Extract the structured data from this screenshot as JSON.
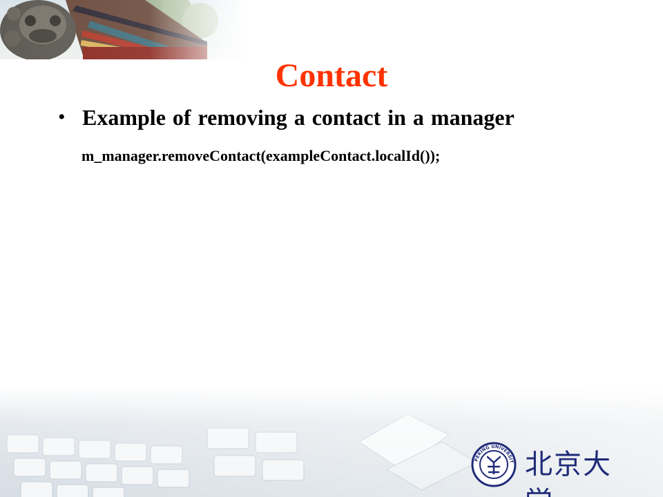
{
  "slide": {
    "title": "Contact",
    "bullet": {
      "marker": "•",
      "text": "Example of removing a contact in a manager"
    },
    "code": "m_manager.removeContact(exampleContact.localId());"
  },
  "logo": {
    "seal_text": "PEKING UNIVERSITY 1898",
    "name": "北京大学"
  },
  "colors": {
    "title": "#ff3300",
    "logo": "#1f2a78"
  }
}
